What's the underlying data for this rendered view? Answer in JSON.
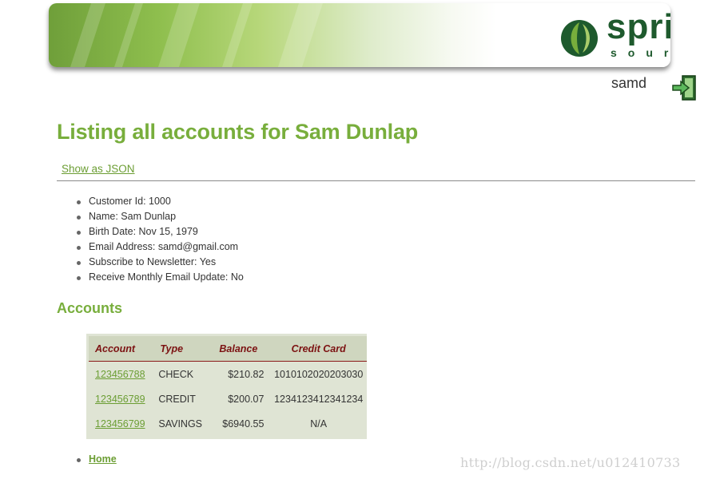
{
  "banner": {
    "logo_word": "spring",
    "logo_sub": "source"
  },
  "header": {
    "username": "samd",
    "logout_icon": "logout-door-arrow-icon"
  },
  "page": {
    "title": "Listing all accounts for Sam Dunlap",
    "json_link": "Show as JSON"
  },
  "customer": {
    "items": [
      "Customer Id: 1000",
      "Name: Sam Dunlap",
      "Birth Date: Nov 15, 1979",
      "Email Address: samd@gmail.com",
      "Subscribe to Newsletter: Yes",
      "Receive Monthly Email Update: No"
    ]
  },
  "accounts": {
    "heading": "Accounts",
    "columns": [
      "Account",
      "Type",
      "Balance",
      "Credit Card"
    ],
    "rows": [
      [
        "123456788",
        "CHECK",
        "$210.82",
        "1010102020203030"
      ],
      [
        "123456789",
        "CREDIT",
        "$200.07",
        "1234123412341234"
      ],
      [
        "123456799",
        "SAVINGS",
        "$6940.55",
        "N/A"
      ]
    ]
  },
  "footer": {
    "home_link": "Home",
    "watermark": "http://blog.csdn.net/u012410733"
  },
  "colors": {
    "accent_green": "#78ae3c",
    "link_green": "#6c9e34",
    "table_header_text": "#7c1212",
    "table_bg": "#dfe4d4",
    "logo_dark_green": "#1e5a2d"
  }
}
